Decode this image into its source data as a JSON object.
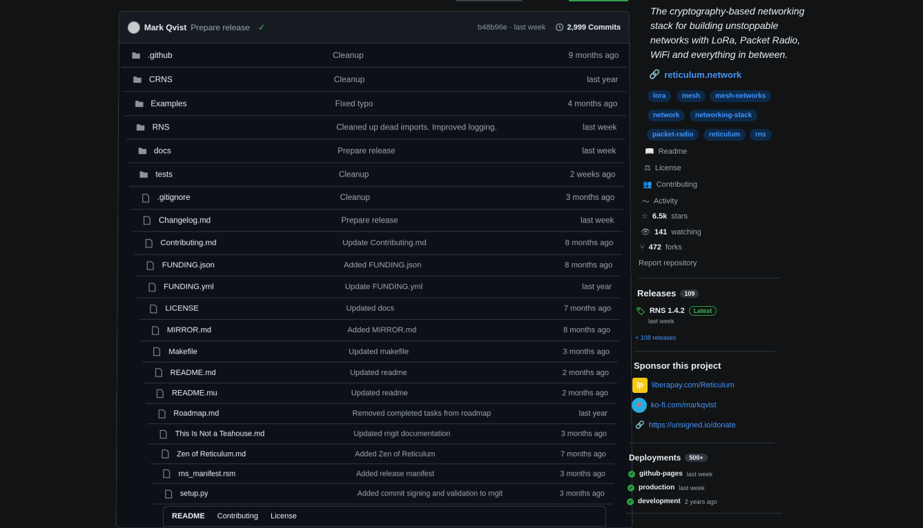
{
  "commit": {
    "author": "Mark Qvist",
    "message": "Prepare release",
    "sha_time": "b48b96e · last week",
    "commits_label": "2,999 Commits"
  },
  "files": [
    {
      "type": "folder",
      "name": ".github",
      "message": "Cleanup",
      "date": "9 months ago"
    },
    {
      "type": "folder",
      "name": "CRNS",
      "message": "Cleanup",
      "date": "last year"
    },
    {
      "type": "folder",
      "name": "Examples",
      "message": "Fixed typo",
      "date": "4 months ago"
    },
    {
      "type": "folder",
      "name": "RNS",
      "message": "Cleaned up dead imports. Improved logging.",
      "date": "last week"
    },
    {
      "type": "folder",
      "name": "docs",
      "message": "Prepare release",
      "date": "last week"
    },
    {
      "type": "folder",
      "name": "tests",
      "message": "Cleanup",
      "date": "2 weeks ago"
    },
    {
      "type": "file",
      "name": ".gitignore",
      "message": "Cleanup",
      "date": "3 months ago"
    },
    {
      "type": "file",
      "name": "Changelog.md",
      "message": "Prepare release",
      "date": "last week"
    },
    {
      "type": "file",
      "name": "Contributing.md",
      "message": "Update Contributing.md",
      "date": "8 months ago"
    },
    {
      "type": "file",
      "name": "FUNDING.json",
      "message": "Added FUNDING.json",
      "date": "8 months ago"
    },
    {
      "type": "file",
      "name": "FUNDING.yml",
      "message": "Update FUNDING.yml",
      "date": "last year"
    },
    {
      "type": "file",
      "name": "LICENSE",
      "message": "Updated docs",
      "date": "7 months ago"
    },
    {
      "type": "file",
      "name": "MIRROR.md",
      "message": "Added MIRROR.md",
      "date": "8 months ago"
    },
    {
      "type": "file",
      "name": "Makefile",
      "message": "Updated makefile",
      "date": "3 months ago"
    },
    {
      "type": "file",
      "name": "README.md",
      "message": "Updated readme",
      "date": "2 months ago"
    },
    {
      "type": "file",
      "name": "README.mu",
      "message": "Updated readme",
      "date": "2 months ago"
    },
    {
      "type": "file",
      "name": "Roadmap.md",
      "message": "Removed completed tasks from roadmap",
      "date": "last year"
    },
    {
      "type": "file",
      "name": "This Is Not a Teahouse.md",
      "message": "Updated rngit documentation",
      "date": "3 months ago"
    },
    {
      "type": "file",
      "name": "Zen of Reticulum.md",
      "message": "Added Zen of Reticulum",
      "date": "7 months ago"
    },
    {
      "type": "file",
      "name": "rns_manifest.rsm",
      "message": "Added release manifest",
      "date": "3 months ago"
    },
    {
      "type": "file",
      "name": "setup.py",
      "message": "Added commit signing and validation to rngit",
      "date": "3 months ago"
    }
  ],
  "readme_tabs": [
    "README",
    "Contributing",
    "License"
  ],
  "about": {
    "description": "The cryptography-based networking stack for building unstoppable networks with LoRa, Packet Radio, WiFi and everything in between.",
    "website": "reticulum.network",
    "topics": [
      "lora",
      "mesh",
      "mesh-networks",
      "network",
      "networking-stack",
      "packet-radio",
      "reticulum",
      "rns"
    ]
  },
  "meta": {
    "readme": "Readme",
    "license": "License",
    "contributing": "Contributing",
    "activity": "Activity",
    "stars_count": "6.5k",
    "stars_label": "stars",
    "watching_count": "141",
    "watching_label": "watching",
    "forks_count": "472",
    "forks_label": "forks",
    "report": "Report repository"
  },
  "releases": {
    "title": "Releases",
    "count": "109",
    "latest_name": "RNS 1.4.2",
    "latest_badge": "Latest",
    "latest_time": "last week",
    "more": "+ 108 releases"
  },
  "sponsor": {
    "title": "Sponsor this project",
    "links": [
      "liberapay.com/Reticulum",
      "ko-fi.com/markqvist",
      "https://unsigned.io/donate"
    ]
  },
  "deployments": {
    "title": "Deployments",
    "count": "500+",
    "items": [
      {
        "name": "github-pages",
        "time": "last week"
      },
      {
        "name": "production",
        "time": "last week"
      },
      {
        "name": "development",
        "time": "2 years ago"
      }
    ]
  },
  "colors": {
    "accent": "#4493f8",
    "success": "#3fb950",
    "background": "#0d1117"
  }
}
